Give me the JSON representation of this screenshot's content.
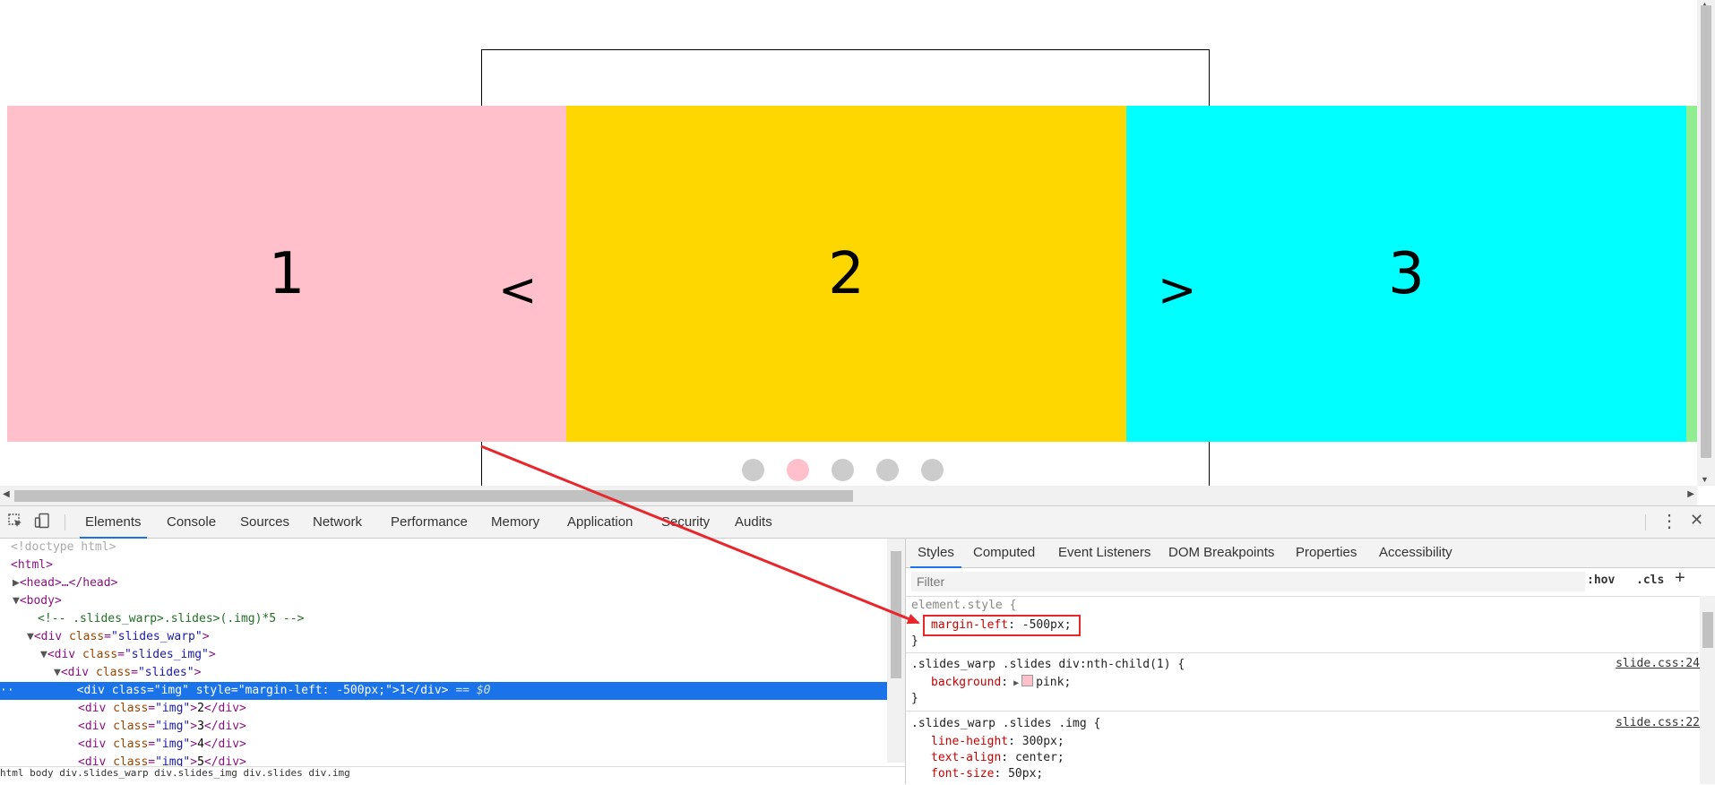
{
  "page": {
    "slides": [
      {
        "label": "1",
        "color": "#ffc0cb"
      },
      {
        "label": "2",
        "color": "#ffd700"
      },
      {
        "label": "3",
        "color": "#00ffff"
      },
      {
        "label": "",
        "color": "#90ee90"
      }
    ],
    "prev_label": "<",
    "next_label": ">",
    "dots": [
      {
        "color": "#cccccc"
      },
      {
        "color": "#ffc0cb"
      },
      {
        "color": "#cccccc"
      },
      {
        "color": "#cccccc"
      },
      {
        "color": "#cccccc"
      }
    ]
  },
  "devtools": {
    "toolbar_tabs": [
      "Elements",
      "Console",
      "Sources",
      "Network",
      "Performance",
      "Memory",
      "Application",
      "Security",
      "Audits"
    ],
    "active_tab": "Elements",
    "dom": {
      "doctype": "<!doctype html>",
      "html": "<html>",
      "head": "<head>…</head>",
      "body": "<body>",
      "comment": "<!-- .slides_warp>.slides>(.img)*5 -->",
      "warp_tag": "div",
      "warp_attr": "class",
      "warp_val": "\"slides_warp\"",
      "img_wrap_val": "\"slides_img\"",
      "slides_val": "\"slides\"",
      "selected_style_attr": "style",
      "selected_style_val": "\"margin-left: -500px;\"",
      "selected_text": "1",
      "selected_marker": "== $0",
      "img_val": "\"img\"",
      "rows": [
        "2",
        "3",
        "4",
        "5"
      ]
    },
    "breadcrumb": "html  body  div.slides_warp  div.slides_img  div.slides  div.img",
    "side_tabs": [
      "Styles",
      "Computed",
      "Event Listeners",
      "DOM Breakpoints",
      "Properties",
      "Accessibility"
    ],
    "active_side_tab": "Styles",
    "filter_placeholder": "Filter",
    "hov": ":hov",
    "cls": ".cls",
    "plus": "+",
    "styles": {
      "element_style": "element.style {",
      "margin_prop": "margin-left",
      "margin_val": "-500px;",
      "close": "}",
      "rule1_selector": ".slides_warp .slides div:nth-child(1) {",
      "rule1_src": "slide.css:24",
      "rule1_prop": "background",
      "rule1_val": "pink;",
      "rule1_swatch": "#ffc0cb",
      "rule2_selector": ".slides_warp .slides .img {",
      "rule2_src": "slide.css:22",
      "rule2_props": [
        {
          "prop": "line-height",
          "val": "300px;"
        },
        {
          "prop": "text-align",
          "val": "center;"
        },
        {
          "prop": "font-size",
          "val": "50px;"
        }
      ]
    },
    "annotation_color": "#e8262b"
  }
}
